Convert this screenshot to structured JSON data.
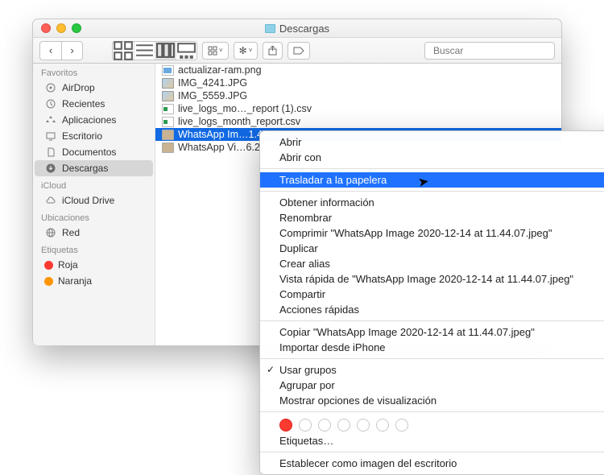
{
  "window": {
    "title": "Descargas"
  },
  "toolbar": {
    "search_placeholder": "Buscar"
  },
  "sidebar": {
    "section_fav": "Favoritos",
    "fav": [
      {
        "label": "AirDrop"
      },
      {
        "label": "Recientes"
      },
      {
        "label": "Aplicaciones"
      },
      {
        "label": "Escritorio"
      },
      {
        "label": "Documentos"
      },
      {
        "label": "Descargas"
      }
    ],
    "section_icloud": "iCloud",
    "icloud": [
      {
        "label": "iCloud Drive"
      }
    ],
    "section_loc": "Ubicaciones",
    "loc": [
      {
        "label": "Red"
      }
    ],
    "section_tags": "Etiquetas",
    "tags": [
      {
        "label": "Roja",
        "color": "#fc3b30"
      },
      {
        "label": "Naranja",
        "color": "#ff9501"
      }
    ]
  },
  "files": [
    {
      "name": "actualizar-ram.png",
      "type": "png"
    },
    {
      "name": "IMG_4241.JPG",
      "type": "img"
    },
    {
      "name": "IMG_5559.JPG",
      "type": "img"
    },
    {
      "name": "live_logs_mo…_report (1).csv",
      "type": "xls"
    },
    {
      "name": "live_logs_month_report.csv",
      "type": "xls"
    },
    {
      "name": "WhatsApp Im…1.44",
      "type": "wa",
      "selected": true
    },
    {
      "name": "WhatsApp Vi…6.26",
      "type": "wa"
    }
  ],
  "menu": {
    "items": [
      {
        "label": "Abrir"
      },
      {
        "label": "Abrir con",
        "submenu": true
      },
      {
        "sep": true
      },
      {
        "label": "Trasladar a la papelera",
        "hover": true
      },
      {
        "sep": true
      },
      {
        "label": "Obtener información"
      },
      {
        "label": "Renombrar"
      },
      {
        "label": "Comprimir \"WhatsApp Image 2020-12-14 at 11.44.07.jpeg\""
      },
      {
        "label": "Duplicar"
      },
      {
        "label": "Crear alias"
      },
      {
        "label": "Vista rápida de \"WhatsApp Image 2020-12-14 at 11.44.07.jpeg\""
      },
      {
        "label": "Compartir",
        "submenu": true
      },
      {
        "label": "Acciones rápidas",
        "submenu": true
      },
      {
        "sep": true
      },
      {
        "label": "Copiar \"WhatsApp Image 2020-12-14 at 11.44.07.jpeg\""
      },
      {
        "label": "Importar desde iPhone",
        "submenu": true
      },
      {
        "sep": true
      },
      {
        "label": "Usar grupos",
        "checked": true
      },
      {
        "label": "Agrupar por",
        "submenu": true
      },
      {
        "label": "Mostrar opciones de visualización"
      },
      {
        "sep": true
      },
      {
        "tagrow": true
      },
      {
        "label": "Etiquetas…"
      },
      {
        "sep": true
      },
      {
        "label": "Establecer como imagen del escritorio"
      }
    ]
  }
}
